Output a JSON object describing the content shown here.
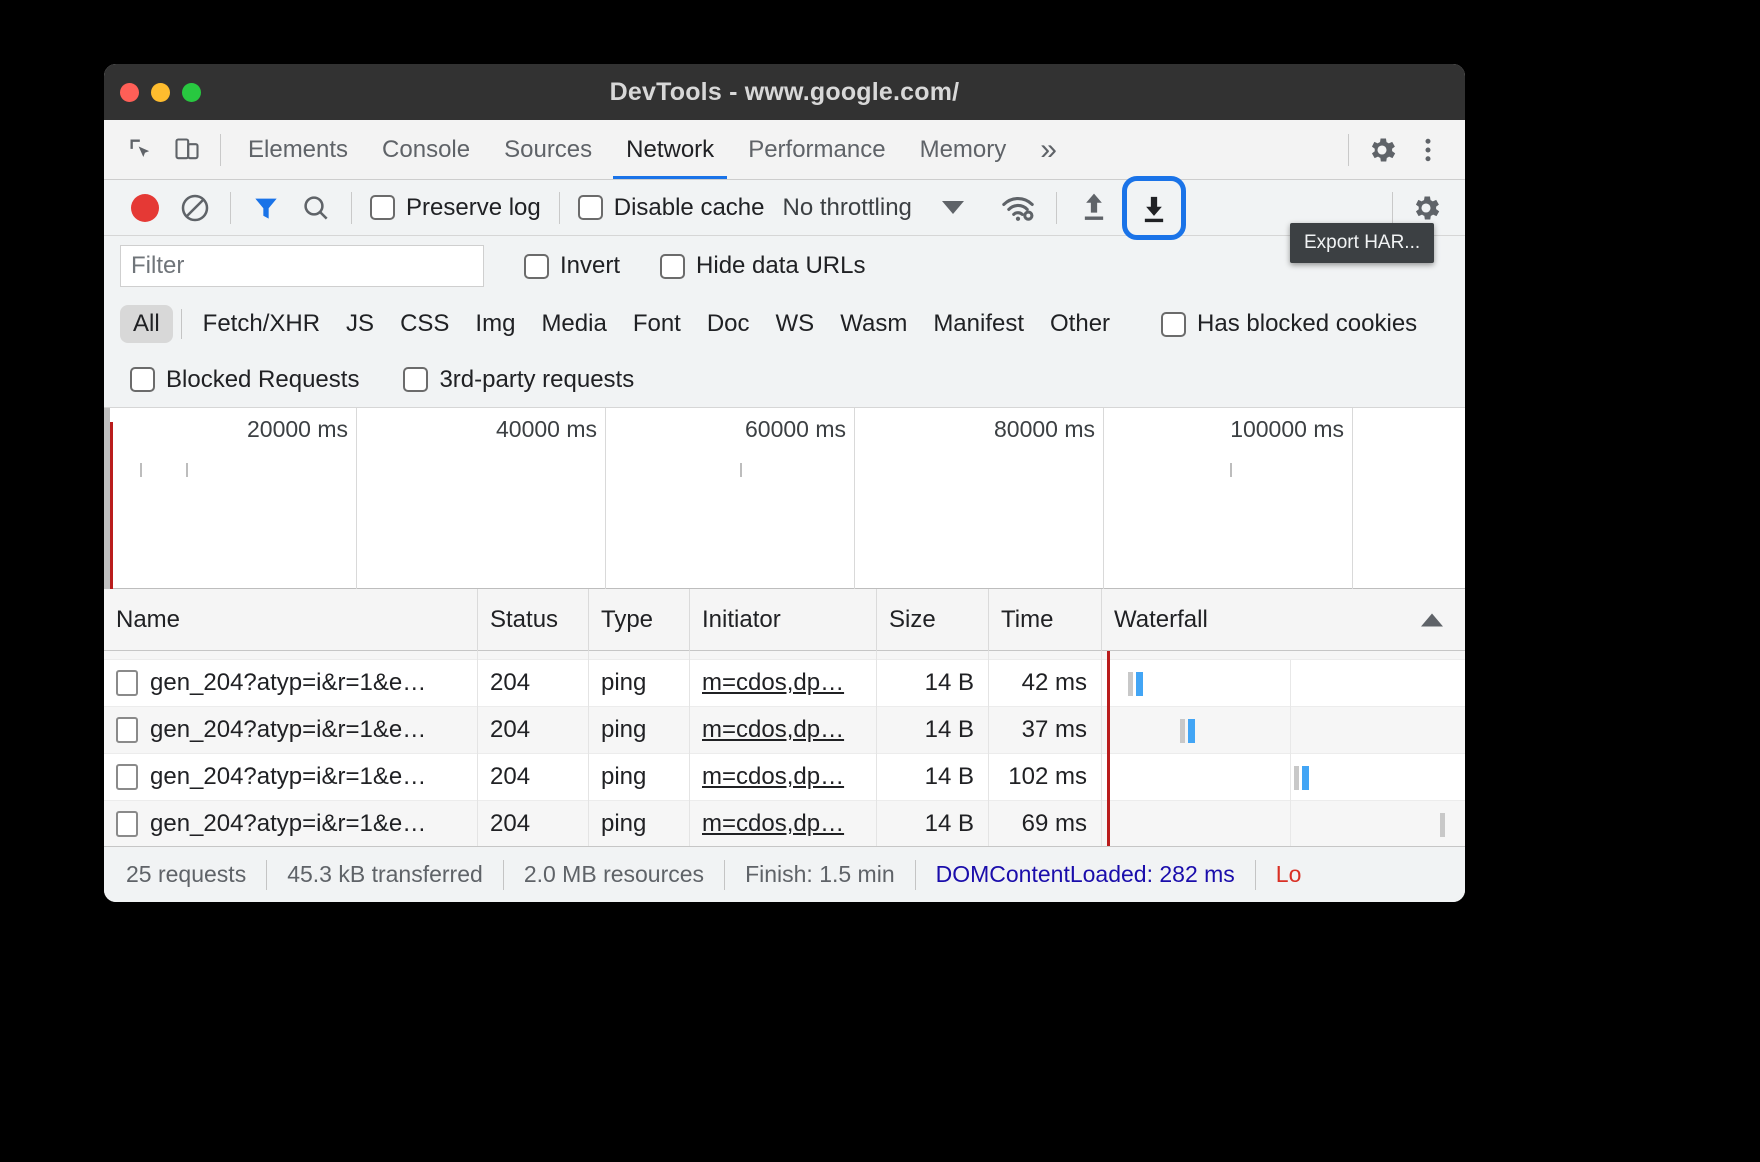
{
  "window": {
    "title": "DevTools - www.google.com/",
    "traffic_lights": [
      "close-red",
      "minimize-yellow",
      "zoom-green"
    ]
  },
  "panel_tabs": {
    "items": [
      {
        "label": "Elements",
        "active": false
      },
      {
        "label": "Console",
        "active": false
      },
      {
        "label": "Sources",
        "active": false
      },
      {
        "label": "Network",
        "active": true
      },
      {
        "label": "Performance",
        "active": false
      },
      {
        "label": "Memory",
        "active": false
      }
    ],
    "overflow_label": "»",
    "inspect_icon": "inspect-element-icon",
    "device_icon": "device-toolbar-icon",
    "settings_icon": "gear-icon",
    "more_icon": "more-vertical-icon"
  },
  "network_toolbar": {
    "record_icon": "record-icon",
    "clear_icon": "clear-icon",
    "filter_icon": "filter-icon",
    "search_icon": "search-icon",
    "preserve_log": {
      "label": "Preserve log",
      "checked": false
    },
    "disable_cache": {
      "label": "Disable cache",
      "checked": false
    },
    "throttling": {
      "value": "No throttling"
    },
    "network_conditions_icon": "wifi-gear-icon",
    "import_har_icon": "upload-arrow-icon",
    "export_har_icon": "download-arrow-icon",
    "export_har_focused": true,
    "settings_icon": "gear-icon",
    "tooltip": "Export HAR..."
  },
  "filter_row": {
    "input": {
      "value": "",
      "placeholder": "Filter"
    },
    "invert": {
      "label": "Invert",
      "checked": false
    },
    "hide_data_urls": {
      "label": "Hide data URLs",
      "checked": false
    }
  },
  "type_filters": {
    "items": [
      {
        "label": "All",
        "active": true
      },
      {
        "label": "Fetch/XHR",
        "active": false
      },
      {
        "label": "JS",
        "active": false
      },
      {
        "label": "CSS",
        "active": false
      },
      {
        "label": "Img",
        "active": false
      },
      {
        "label": "Media",
        "active": false
      },
      {
        "label": "Font",
        "active": false
      },
      {
        "label": "Doc",
        "active": false
      },
      {
        "label": "WS",
        "active": false
      },
      {
        "label": "Wasm",
        "active": false
      },
      {
        "label": "Manifest",
        "active": false
      },
      {
        "label": "Other",
        "active": false
      }
    ],
    "has_blocked_cookies": {
      "label": "Has blocked cookies",
      "checked": false
    },
    "blocked_requests": {
      "label": "Blocked Requests",
      "checked": false
    },
    "third_party_requests": {
      "label": "3rd-party requests",
      "checked": false
    }
  },
  "overview": {
    "ticks": [
      "20000 ms",
      "40000 ms",
      "60000 ms",
      "80000 ms",
      "100000 ms"
    ],
    "load_event_color": "#b91c1c"
  },
  "table": {
    "columns": [
      {
        "label": "Name"
      },
      {
        "label": "Status"
      },
      {
        "label": "Type"
      },
      {
        "label": "Initiator"
      },
      {
        "label": "Size"
      },
      {
        "label": "Time"
      },
      {
        "label": "Waterfall",
        "sorted": "asc"
      }
    ],
    "rows": [
      {
        "name": "gen_204?atyp=i&r=1&e…",
        "status": "204",
        "type": "ping",
        "initiator": "m=cdos,dp…",
        "size": "14 B",
        "time": "42 ms"
      },
      {
        "name": "gen_204?atyp=i&r=1&e…",
        "status": "204",
        "type": "ping",
        "initiator": "m=cdos,dp…",
        "size": "14 B",
        "time": "37 ms"
      },
      {
        "name": "gen_204?atyp=i&r=1&e…",
        "status": "204",
        "type": "ping",
        "initiator": "m=cdos,dp…",
        "size": "14 B",
        "time": "102 ms"
      },
      {
        "name": "gen_204?atyp=i&r=1&e…",
        "status": "204",
        "type": "ping",
        "initiator": "m=cdos,dp…",
        "size": "14 B",
        "time": "69 ms"
      }
    ]
  },
  "status_bar": {
    "requests": "25 requests",
    "transferred": "45.3 kB transferred",
    "resources": "2.0 MB resources",
    "finish": "Finish: 1.5 min",
    "dom_content_loaded": "DOMContentLoaded: 282 ms",
    "load": "Lo"
  },
  "colors": {
    "accent_blue": "#1a73e8",
    "waterfall_blue": "#42a5f5",
    "load_red": "#d93025",
    "dcl_blue": "#1a0dab"
  }
}
